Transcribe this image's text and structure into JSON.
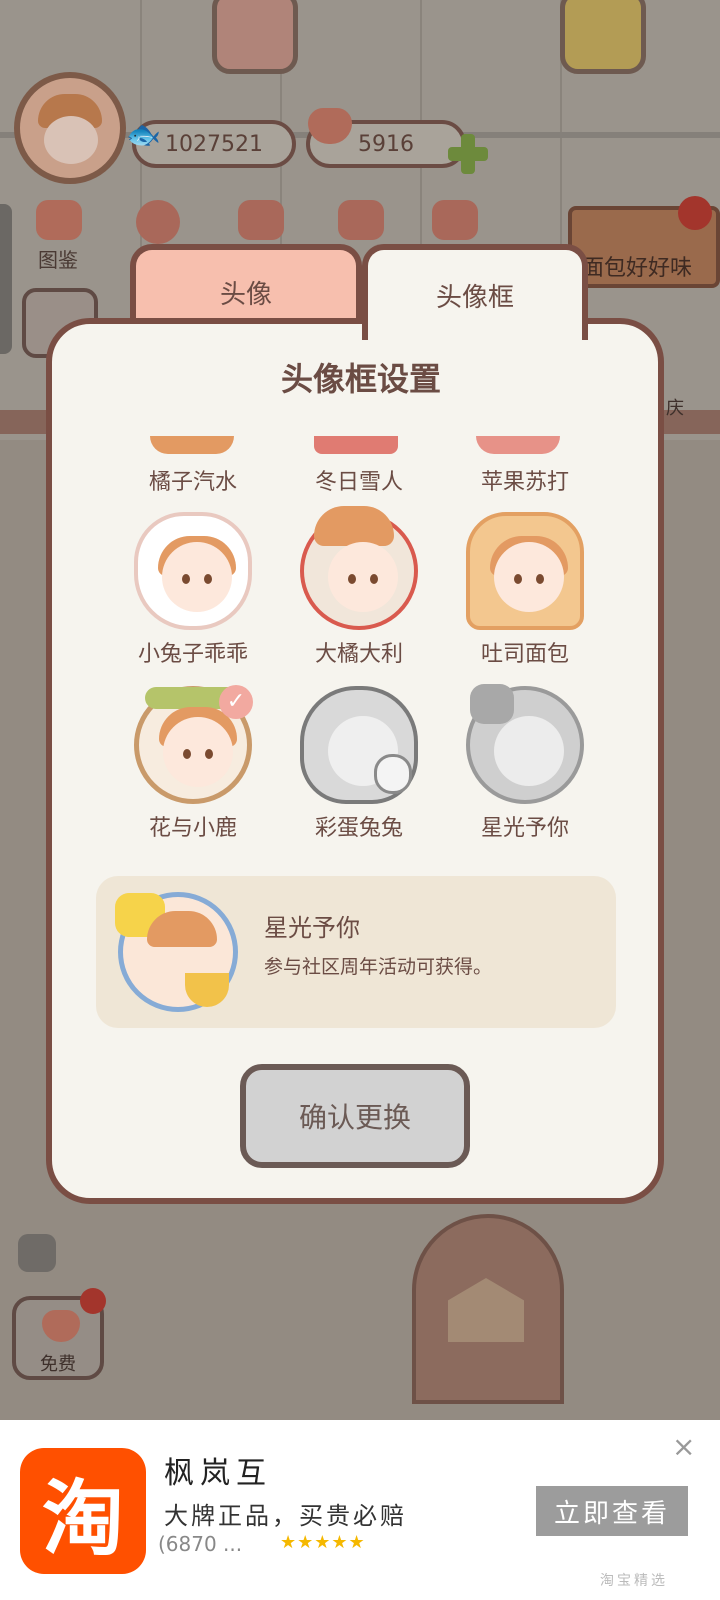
{
  "hud": {
    "fish_count": "1027521",
    "heart_count": "5916",
    "menu_guide_label": "图鉴",
    "bread_sign": "面包好好味",
    "free_label": "免费",
    "side_label": "庆"
  },
  "tabs": [
    {
      "label": "头像"
    },
    {
      "label": "头像框"
    }
  ],
  "modal": {
    "title": "头像框设置",
    "frames": [
      {
        "name": "橘子汽水"
      },
      {
        "name": "冬日雪人"
      },
      {
        "name": "苹果苏打"
      },
      {
        "name": "小兔子乖乖"
      },
      {
        "name": "大橘大利"
      },
      {
        "name": "吐司面包"
      },
      {
        "name": "花与小鹿",
        "selected": true
      },
      {
        "name": "彩蛋兔兔"
      },
      {
        "name": "星光予你"
      }
    ],
    "info": {
      "name": "星光予你",
      "description": "参与社区周年活动可获得。"
    },
    "confirm_label": "确认更换"
  },
  "ad": {
    "title": "枫岚互",
    "slogan": "大牌正品，买贵必赔",
    "rating_count": "(6870 ...",
    "stars": "★★★★★",
    "button": "立即查看",
    "source": "淘宝精选",
    "logo_char": "淘",
    "close": "×"
  },
  "colors": {
    "modal_border": "#7a4e44",
    "tab_active": "#f6f4ee",
    "tab_inactive": "#f7bfae",
    "ad_brand": "#ff5000"
  }
}
